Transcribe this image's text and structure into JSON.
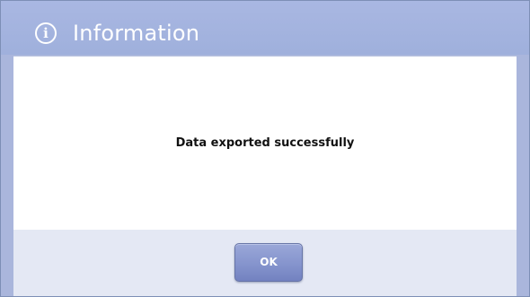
{
  "dialog": {
    "title": "Information",
    "icon": "info-icon",
    "icon_glyph": "i",
    "message": "Data exported successfully",
    "ok_label": "OK"
  }
}
